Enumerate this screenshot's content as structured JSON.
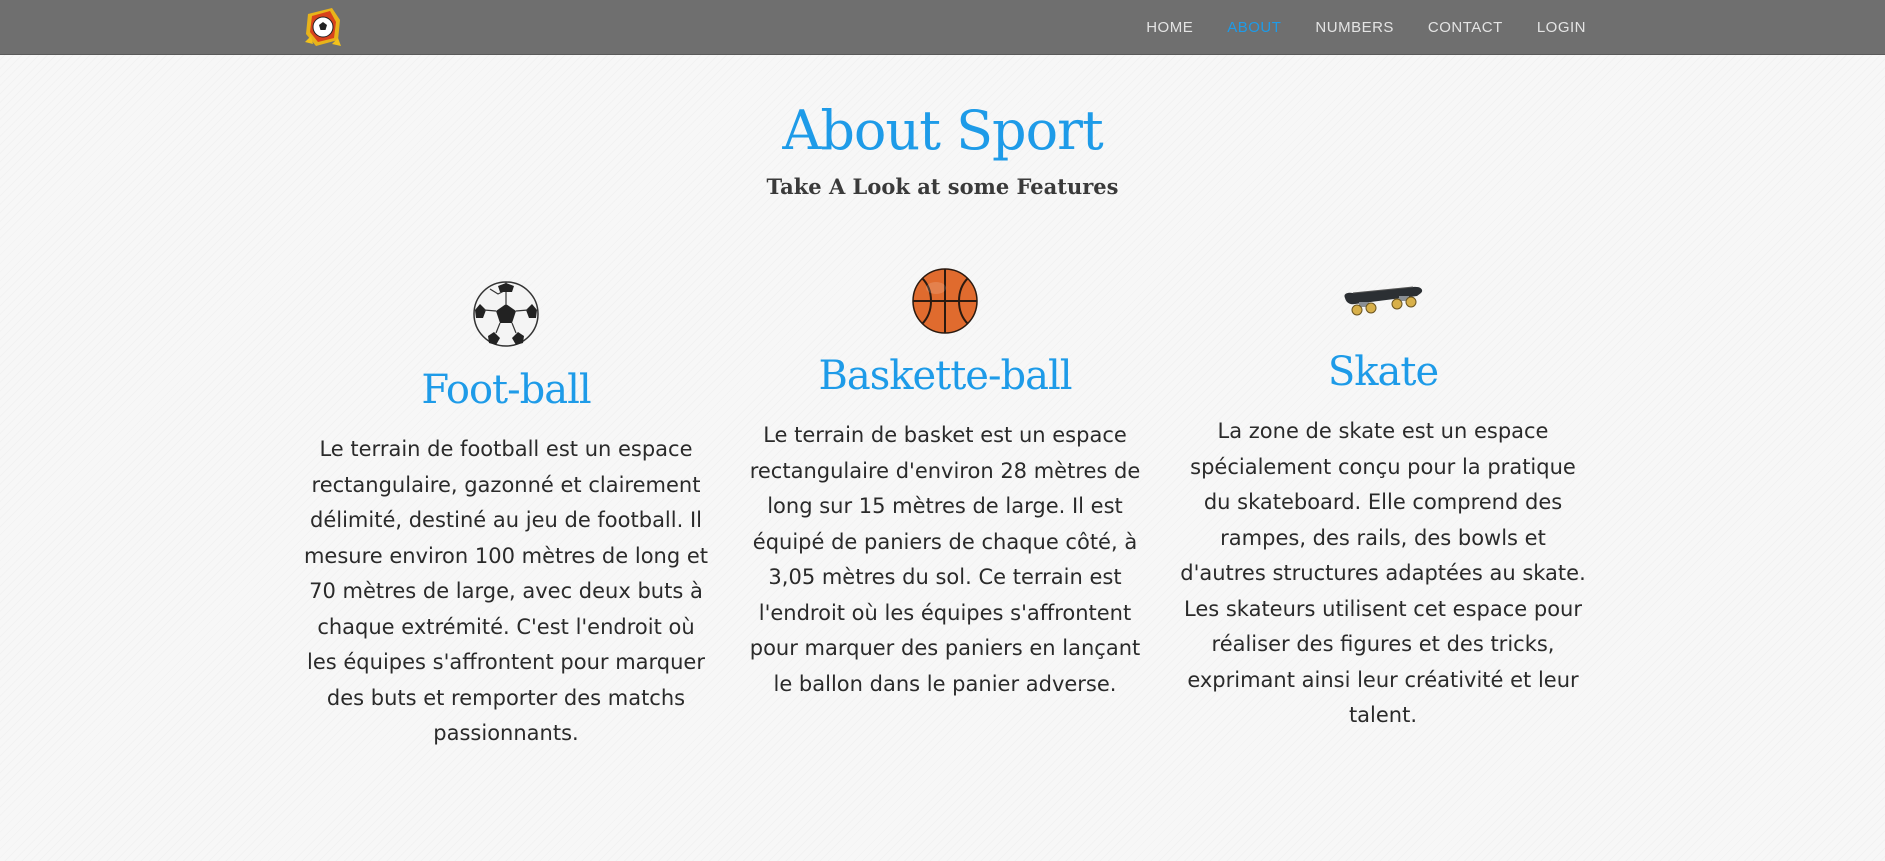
{
  "nav": {
    "logo": "soccer-ball-logo-icon",
    "links": [
      {
        "label": "HOME",
        "active": false
      },
      {
        "label": "ABOUT",
        "active": true
      },
      {
        "label": "NUMBERS",
        "active": false
      },
      {
        "label": "CONTACT",
        "active": false
      },
      {
        "label": "LOGIN",
        "active": false
      }
    ]
  },
  "about": {
    "title": "About Sport",
    "subtitle": "Take A Look at some Features"
  },
  "features": [
    {
      "icon": "soccer-ball-icon",
      "title": "Foot-ball",
      "text": "Le terrain de football est un espace rectangulaire, gazonné et clairement délimité, destiné au jeu de football. Il mesure environ 100 mètres de long et 70 mètres de large, avec deux buts à chaque extrémité. C'est l'endroit où les équipes s'affrontent pour marquer des buts et remporter des matchs passionnants."
    },
    {
      "icon": "basketball-icon",
      "title": "Baskette-ball",
      "text": "Le terrain de basket est un espace rectangulaire d'environ 28 mètres de long sur 15 mètres de large. Il est équipé de paniers de chaque côté, à 3,05 mètres du sol. Ce terrain est l'endroit où les équipes s'affrontent pour marquer des paniers en lançant le ballon dans le panier adverse."
    },
    {
      "icon": "skateboard-icon",
      "title": "Skate",
      "text": "La zone de skate est un espace spécialement conçu pour la pratique du skateboard. Elle comprend des rampes, des rails, des bowls et d'autres structures adaptées au skate. Les skateurs utilisent cet espace pour réaliser des figures et des tricks, exprimant ainsi leur créativité et leur talent."
    }
  ],
  "colors": {
    "accent": "#1e9be8",
    "navbar": "#6f6f6f",
    "nav_text": "#e4e4e4",
    "body_text": "#2a2a2a"
  }
}
